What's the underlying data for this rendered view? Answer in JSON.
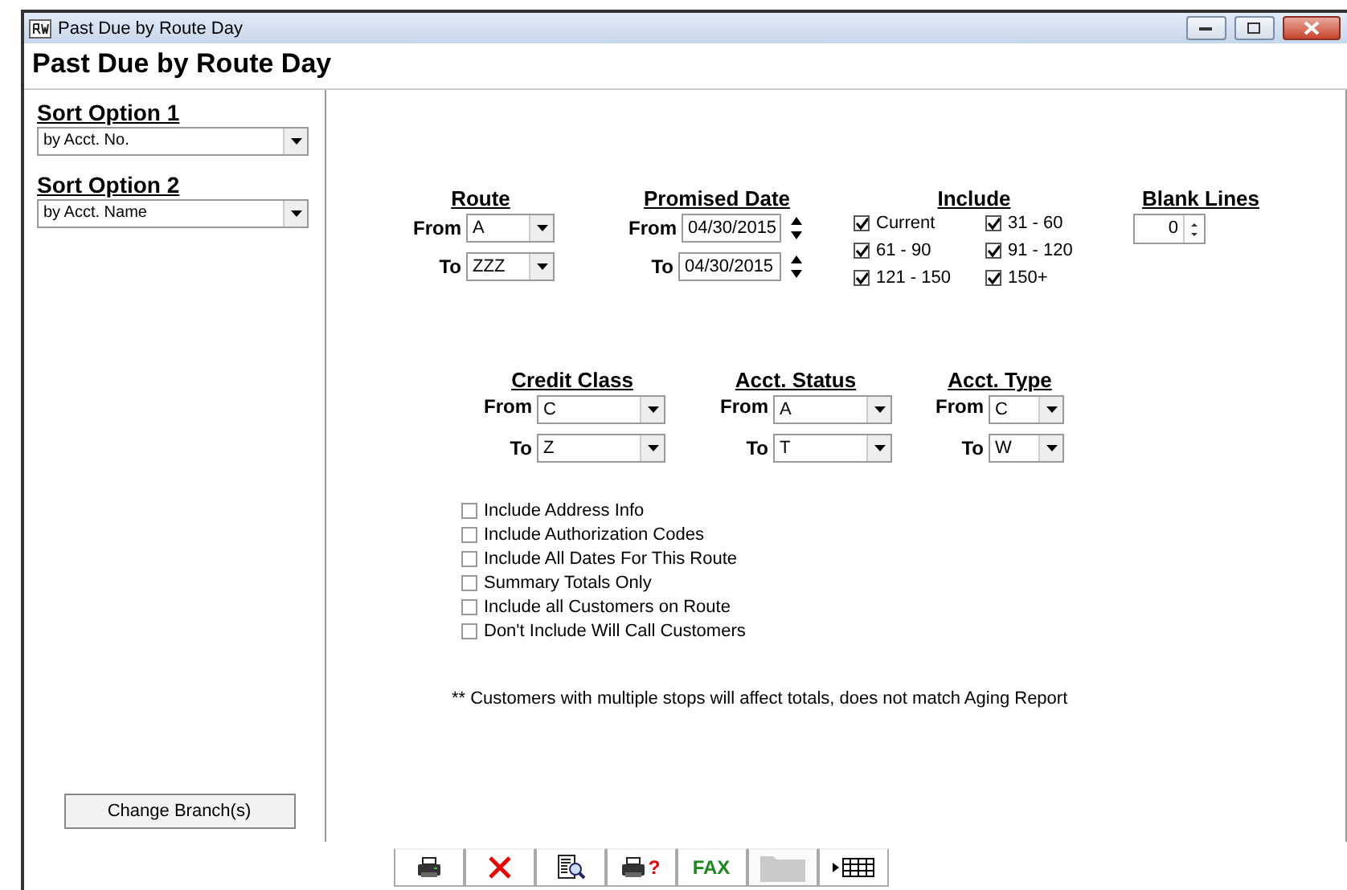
{
  "window": {
    "title": "Past Due by Route Day"
  },
  "header": "Past Due by Route Day",
  "sort_options": [
    {
      "label": "Sort Option 1",
      "value": "by Acct. No."
    },
    {
      "label": "Sort Option 2",
      "value": "by Acct. Name"
    }
  ],
  "change_branch_button": "Change Branch(s)",
  "route": {
    "title": "Route",
    "rows": [
      {
        "label": "From",
        "value": "A"
      },
      {
        "label": "To",
        "value": "ZZZ"
      }
    ]
  },
  "promised_date": {
    "title": "Promised Date",
    "rows": [
      {
        "label": "From",
        "value": "04/30/2015"
      },
      {
        "label": "To",
        "value": "04/30/2015"
      }
    ]
  },
  "include": {
    "title": "Include",
    "items": [
      {
        "label": "Current",
        "checked": true
      },
      {
        "label": "31 - 60",
        "checked": true
      },
      {
        "label": "61 - 90",
        "checked": true
      },
      {
        "label": "91 - 120",
        "checked": true
      },
      {
        "label": "121 - 150",
        "checked": true
      },
      {
        "label": "150+",
        "checked": true
      }
    ]
  },
  "blank_lines": {
    "title": "Blank Lines",
    "value": "0"
  },
  "credit_class": {
    "title": "Credit Class",
    "rows": [
      {
        "label": "From",
        "value": "C"
      },
      {
        "label": "To",
        "value": "Z"
      }
    ]
  },
  "acct_status": {
    "title": "Acct. Status",
    "rows": [
      {
        "label": "From",
        "value": "A"
      },
      {
        "label": "To",
        "value": "T"
      }
    ]
  },
  "acct_type": {
    "title": "Acct. Type",
    "rows": [
      {
        "label": "From",
        "value": "C"
      },
      {
        "label": "To",
        "value": "W"
      }
    ]
  },
  "options": [
    {
      "label": "Include Address Info",
      "checked": false
    },
    {
      "label": "Include Authorization Codes",
      "checked": false
    },
    {
      "label": "Include All Dates For This Route",
      "checked": false
    },
    {
      "label": "Summary Totals Only",
      "checked": false
    },
    {
      "label": "Include all Customers on Route",
      "checked": false
    },
    {
      "label": "Don't Include Will Call Customers",
      "checked": false
    }
  ],
  "note": "** Customers with multiple stops will affect totals, does not match Aging Report",
  "toolbar": [
    {
      "kind": "print",
      "disabled": false
    },
    {
      "kind": "cancel",
      "disabled": false
    },
    {
      "kind": "preview",
      "disabled": false
    },
    {
      "kind": "print_query",
      "label": "?",
      "disabled": false
    },
    {
      "kind": "fax",
      "label": "FAX",
      "disabled": false
    },
    {
      "kind": "blank",
      "disabled": true
    },
    {
      "kind": "grid",
      "disabled": false
    }
  ]
}
